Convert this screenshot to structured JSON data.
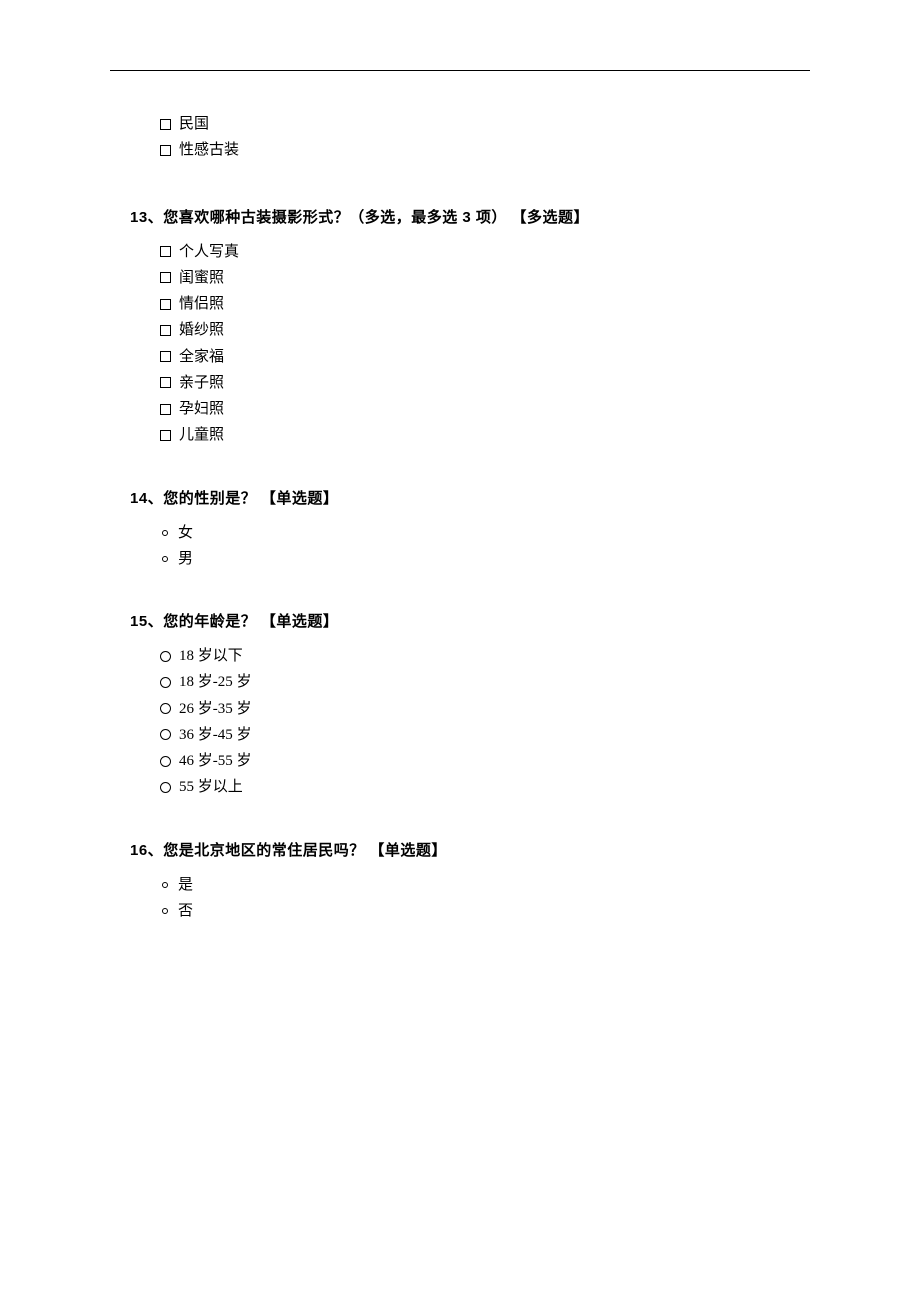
{
  "orphan": {
    "options": [
      "民国",
      "性感古装"
    ]
  },
  "questions": [
    {
      "number": "13、",
      "title": "您喜欢哪种古装摄影形式？（多选，最多选 3 项） 【多选题】",
      "type": "checkbox",
      "options": [
        "个人写真",
        "闺蜜照",
        "情侣照",
        "婚纱照",
        "全家福",
        "亲子照",
        "孕妇照",
        "儿童照"
      ]
    },
    {
      "number": "14、",
      "title": "您的性别是？  【单选题】",
      "type": "bullet",
      "options": [
        "女",
        "男"
      ]
    },
    {
      "number": "15、",
      "title": "您的年龄是？  【单选题】",
      "type": "radio",
      "options": [
        "18 岁以下",
        "18 岁-25 岁",
        "26 岁-35 岁",
        "36 岁-45 岁",
        "46 岁-55 岁",
        "55 岁以上"
      ]
    },
    {
      "number": "16、",
      "title": "您是北京地区的常住居民吗？  【单选题】",
      "type": "bullet",
      "options": [
        "是",
        "否"
      ]
    }
  ]
}
